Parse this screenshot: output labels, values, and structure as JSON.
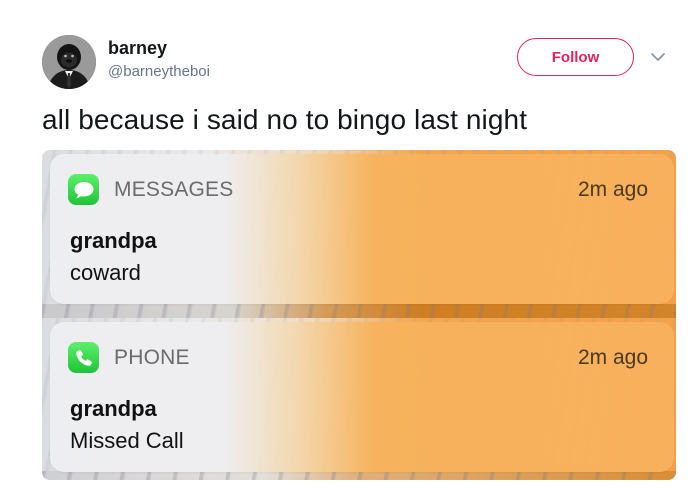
{
  "tweet": {
    "author": {
      "display_name": "barney",
      "handle": "@barneytheboi",
      "avatar_icon": "gorilla-avatar"
    },
    "follow_label": "Follow",
    "menu_icon": "chevron-down-icon",
    "text": "all because i said no to bingo last night",
    "accent_color": "#e0245e"
  },
  "photo": {
    "notifications": [
      {
        "app": "MESSAGES",
        "icon": "messages-bubble-icon",
        "time": "2m ago",
        "sender": "grandpa",
        "body": "coward"
      },
      {
        "app": "PHONE",
        "icon": "phone-handset-icon",
        "time": "2m ago",
        "sender": "grandpa",
        "body": "Missed Call"
      }
    ]
  }
}
